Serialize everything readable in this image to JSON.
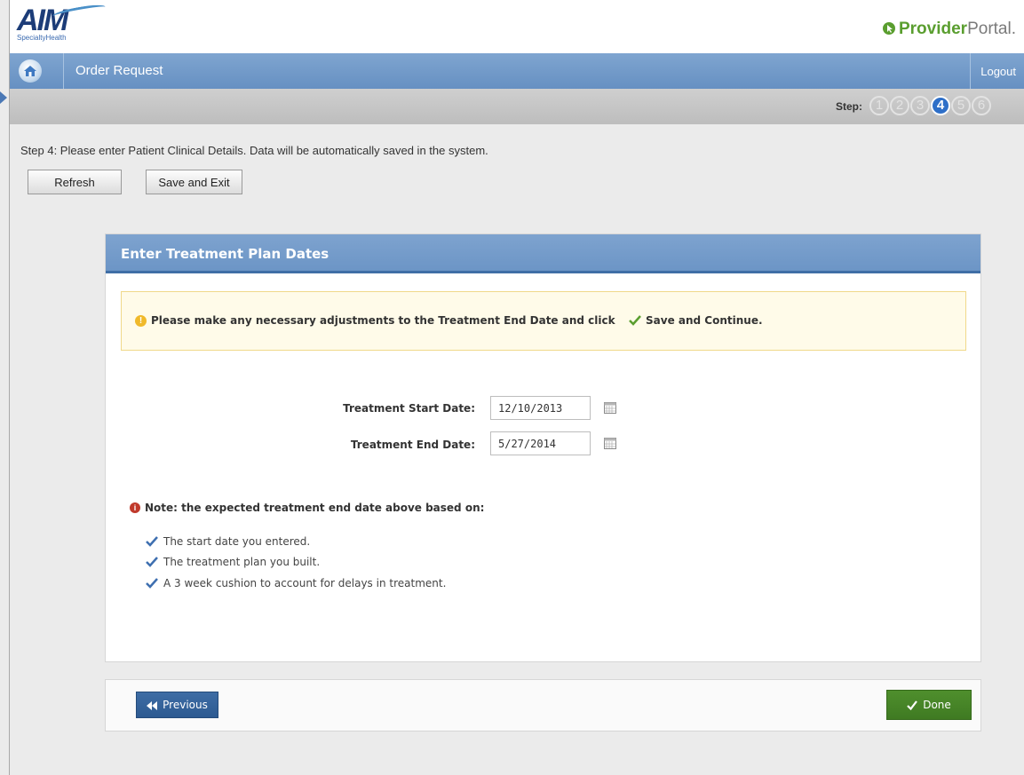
{
  "header": {
    "logo_text": "AIM",
    "logo_sub": "SpecialtyHealth",
    "portal_provider": "Provider",
    "portal_suffix": "Portal."
  },
  "nav": {
    "title": "Order Request",
    "logout": "Logout",
    "home_icon": "home-icon"
  },
  "steps": {
    "label": "Step:",
    "items": [
      "1",
      "2",
      "3",
      "4",
      "5",
      "6"
    ],
    "active": "4"
  },
  "instructions": "Step 4:  Please enter Patient Clinical Details.  Data will be automatically saved in the system.",
  "toolbar": {
    "refresh_label": "Refresh",
    "save_exit_label": "Save and Exit"
  },
  "panel": {
    "title": "Enter Treatment Plan Dates",
    "alert_text": "Please make any necessary adjustments to the Treatment End Date and click",
    "alert_action": "Save and Continue.",
    "start_label": "Treatment Start Date:",
    "start_value": "12/10/2013",
    "end_label": "Treatment End Date:",
    "end_value": "5/27/2014",
    "note_title": "Note: the expected treatment end date above based on:",
    "note_items": [
      "The start date you entered.",
      "The treatment plan you built.",
      "A 3 week cushion to account for delays in treatment."
    ]
  },
  "footer": {
    "previous_label": "Previous",
    "done_label": "Done"
  },
  "colors": {
    "nav_blue": "#6c95c6",
    "active_step": "#2e6fc8",
    "done_green": "#4f8f2d",
    "previous_blue": "#3e6da5",
    "alert_bg": "#fffbe9"
  }
}
